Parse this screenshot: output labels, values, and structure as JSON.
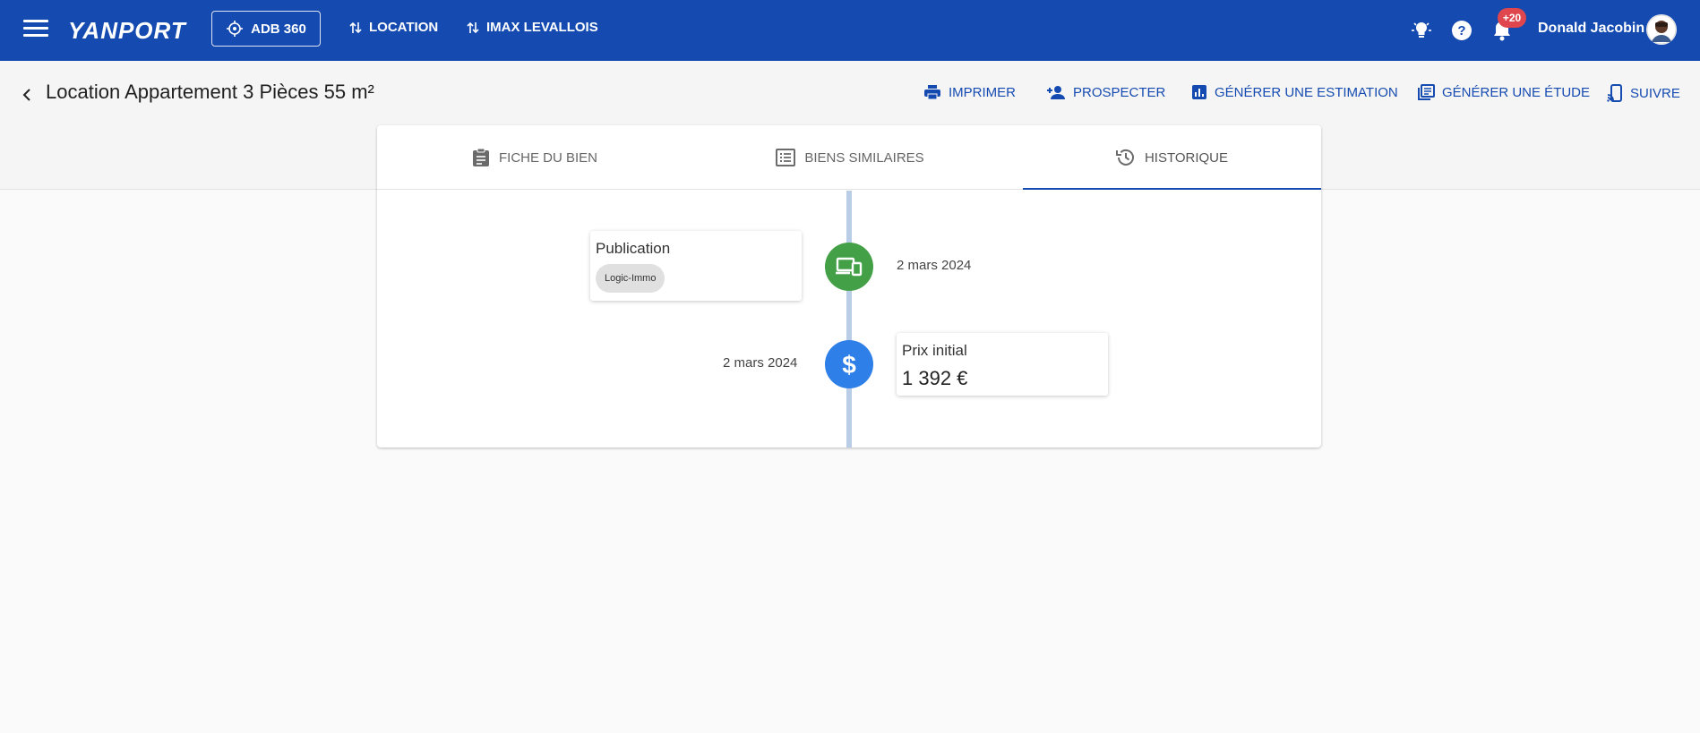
{
  "topbar": {
    "logo": "YANPORT",
    "adb_button": "ADB 360",
    "location_link": "LOCATION",
    "agency_link": "IMAX LEVALLOIS",
    "notification_count": "+20",
    "user_name": "Donald Jacobin",
    "brand_color": "#154bb1"
  },
  "header": {
    "title": "Location Appartement 3 Pièces 55 m²",
    "actions": {
      "print": "IMPRIMER",
      "prospect": "PROSPECTER",
      "estimate": "GÉNÉRER UNE ESTIMATION",
      "study": "GÉNÉRER UNE ÉTUDE",
      "follow": "SUIVRE"
    }
  },
  "tabs": {
    "sheet": "FICHE DU BIEN",
    "similar": "BIENS SIMILAIRES",
    "history": "HISTORIQUE",
    "active": "HISTORIQUE"
  },
  "timeline": {
    "events": [
      {
        "title": "Publication",
        "chip": "Logic-Immo",
        "date": "2 mars 2024",
        "icon": "devices-icon",
        "color": "#43a047"
      },
      {
        "title": "Prix initial",
        "value": "1 392 €",
        "date": "2 mars 2024",
        "icon": "dollar-icon",
        "color": "#2f7fe8"
      }
    ]
  }
}
